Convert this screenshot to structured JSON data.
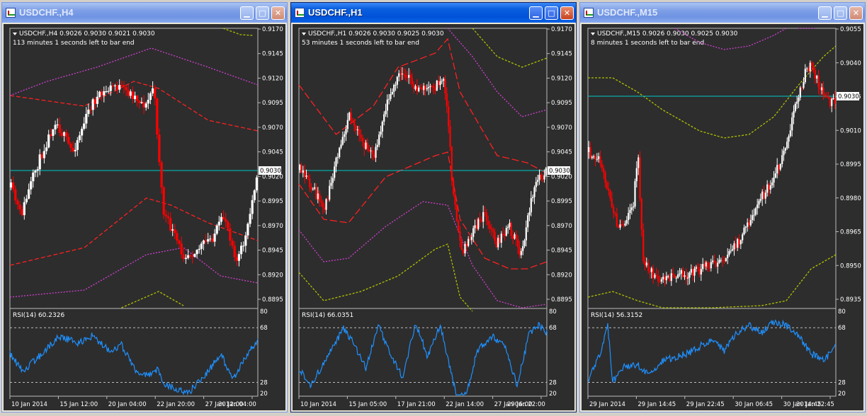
{
  "colors": {
    "bull": "#ffffff",
    "bear": "#ff0000",
    "env_inner": "#ff2020",
    "env_mid": "#d040d0",
    "env_outer": "#b0c000",
    "rsi": "#1e90ff",
    "price_line": "#00c8c8",
    "background": "#2d2d2d",
    "axis_text": "#ffffff"
  },
  "windows": [
    {
      "title": "USDCHF.,H4",
      "state": "inactive",
      "buttons": [
        "minimize-icon",
        "maximize-icon",
        "close-icon"
      ],
      "info_line": "USDCHF.,H4  0.9026 0.9030 0.9021 0.9030",
      "timer": "113 minutes 1 seconds left to bar end",
      "rsi_label": "RSI(14) 60.2326",
      "price_axis": [
        "0.9170",
        "0.9145",
        "0.9120",
        "0.9095",
        "0.9070",
        "0.9045",
        "0.9020",
        "0.8995",
        "0.8970",
        "0.8945",
        "0.8920",
        "0.8895"
      ],
      "current_price": "0.9030",
      "rsi_axis": [
        "80",
        "68",
        "28",
        "20"
      ],
      "time_axis": [
        "10 Jan 2014",
        "15 Jan 12:00",
        "20 Jan 04:00",
        "22 Jan 20:00",
        "27 Jan 12:00",
        "30 Jan 04:00"
      ],
      "chart_data": {
        "type": "candlestick",
        "symbol": "USDCHF.",
        "timeframe": "H4",
        "open": 0.9026,
        "high": 0.903,
        "low": 0.9021,
        "close": 0.903,
        "ylim": [
          0.8885,
          0.9172
        ],
        "rsi": {
          "period": 14,
          "value": 60.2326,
          "levels": [
            68,
            28
          ],
          "ylim": [
            20,
            80
          ]
        }
      }
    },
    {
      "title": "USDCHF.,H1",
      "state": "active",
      "buttons": [
        "minimize-icon",
        "maximize-icon",
        "close-icon"
      ],
      "info_line": "USDCHF.,H1  0.9026 0.9030 0.9025 0.9030",
      "timer": "53 minutes 1 seconds left to bar end",
      "rsi_label": "RSI(14) 66.0351",
      "price_axis": [
        "0.9170",
        "0.9145",
        "0.9120",
        "0.9095",
        "0.9070",
        "0.9045",
        "0.9020",
        "0.8995",
        "0.8970",
        "0.8945",
        "0.8920",
        "0.8895"
      ],
      "current_price": "0.9030",
      "rsi_axis": [
        "80",
        "68",
        "28",
        "20"
      ],
      "time_axis": [
        "10 Jan 2014",
        "15 Jan 05:00",
        "17 Jan 21:00",
        "22 Jan 14:00",
        "27 Jan 06:00",
        "29 Jan 22:00"
      ],
      "chart_data": {
        "type": "candlestick",
        "symbol": "USDCHF.",
        "timeframe": "H1",
        "open": 0.9026,
        "high": 0.903,
        "low": 0.9025,
        "close": 0.903,
        "ylim": [
          0.8885,
          0.9172
        ],
        "rsi": {
          "period": 14,
          "value": 66.0351,
          "levels": [
            68,
            28
          ],
          "ylim": [
            20,
            80
          ]
        }
      }
    },
    {
      "title": "USDCHF.,M15",
      "state": "inactive",
      "buttons": [
        "minimize-icon",
        "maximize-icon",
        "close-icon"
      ],
      "info_line": "USDCHF.,M15  0.9026 0.9030 0.9025 0.9030",
      "timer": "8 minutes 1 seconds left to bar end",
      "rsi_label": "RSI(14) 56.3152",
      "price_axis": [
        "0.9055",
        "0.9040",
        "0.9025",
        "0.9010",
        "0.8995",
        "0.8980",
        "0.8965",
        "0.8950",
        "0.8935"
      ],
      "current_price": "0.9030",
      "rsi_axis": [
        "80",
        "68",
        "28",
        "20"
      ],
      "time_axis": [
        "29 Jan 2014",
        "29 Jan 14:45",
        "29 Jan 22:45",
        "30 Jan 06:45",
        "30 Jan 14:45",
        "30 Jan 22:45"
      ],
      "chart_data": {
        "type": "candlestick",
        "symbol": "USDCHF.",
        "timeframe": "M15",
        "open": 0.9026,
        "high": 0.903,
        "low": 0.9025,
        "close": 0.903,
        "ylim": [
          0.8928,
          0.9062
        ],
        "rsi": {
          "period": 14,
          "value": 56.3152,
          "levels": [
            68,
            28
          ],
          "ylim": [
            20,
            80
          ]
        }
      }
    }
  ]
}
